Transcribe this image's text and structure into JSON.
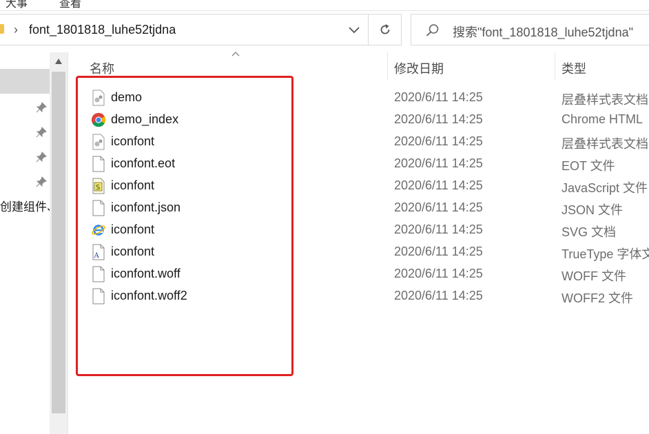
{
  "ribbon": {
    "items": [
      "大事",
      "查看"
    ]
  },
  "address_bar": {
    "path": "font_1801818_luhe52tjdna"
  },
  "search": {
    "placeholder": "搜索\"font_1801818_luhe52tjdna\""
  },
  "nav_pane": {
    "partial_label": "创建组件、"
  },
  "columns": {
    "name": "名称",
    "date": "修改日期",
    "type": "类型"
  },
  "files": [
    {
      "name": "demo",
      "date": "2020/6/11 14:25",
      "type": "层叠样式表文档",
      "icon": "css-file-icon"
    },
    {
      "name": "demo_index",
      "date": "2020/6/11 14:25",
      "type": "Chrome HTML",
      "icon": "chrome-icon"
    },
    {
      "name": "iconfont",
      "date": "2020/6/11 14:25",
      "type": "层叠样式表文档",
      "icon": "css-file-icon"
    },
    {
      "name": "iconfont.eot",
      "date": "2020/6/11 14:25",
      "type": "EOT 文件",
      "icon": "blank-file-icon"
    },
    {
      "name": "iconfont",
      "date": "2020/6/11 14:25",
      "type": "JavaScript 文件",
      "icon": "js-file-icon"
    },
    {
      "name": "iconfont.json",
      "date": "2020/6/11 14:25",
      "type": "JSON 文件",
      "icon": "blank-file-icon"
    },
    {
      "name": "iconfont",
      "date": "2020/6/11 14:25",
      "type": "SVG 文档",
      "icon": "ie-icon"
    },
    {
      "name": "iconfont",
      "date": "2020/6/11 14:25",
      "type": "TrueType 字体文件",
      "icon": "font-file-icon"
    },
    {
      "name": "iconfont.woff",
      "date": "2020/6/11 14:25",
      "type": "WOFF 文件",
      "icon": "blank-file-icon"
    },
    {
      "name": "iconfont.woff2",
      "date": "2020/6/11 14:25",
      "type": "WOFF2 文件",
      "icon": "blank-file-icon"
    }
  ],
  "colors": {
    "highlight": "#e02020",
    "selection": "#d9d9d9"
  }
}
